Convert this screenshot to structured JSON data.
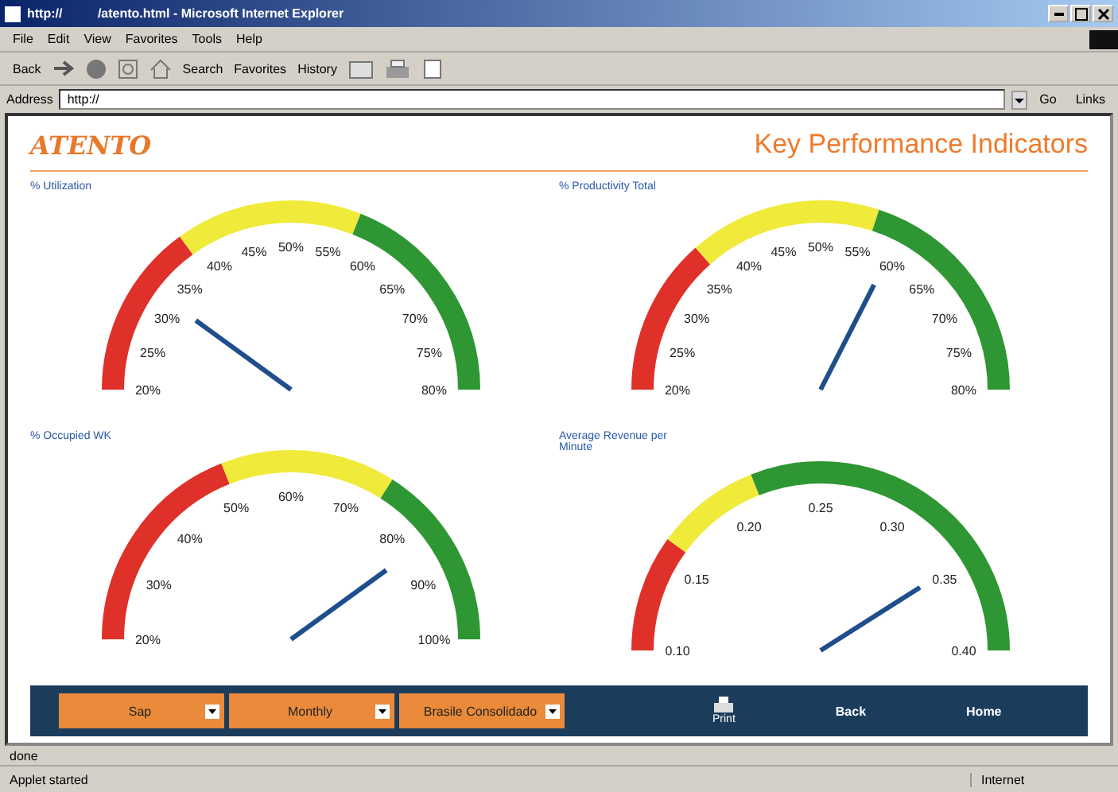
{
  "window": {
    "title": "http://          /atento.html - Microsoft Internet Explorer"
  },
  "menu": [
    "File",
    "Edit",
    "View",
    "Favorites",
    "Tools",
    "Help"
  ],
  "toolbar": [
    "Back",
    "Search",
    "Favorites",
    "History"
  ],
  "address": {
    "label": "Address",
    "value": "http://",
    "go": "Go",
    "links": "Links"
  },
  "page": {
    "logo": "ATENTO",
    "title": "Key Performance Indicators"
  },
  "gauges": [
    {
      "title": "% Utilization",
      "ticks": [
        "20%",
        "25%",
        "30%",
        "35%",
        "40%",
        "45%",
        "50%",
        "55%",
        "60%",
        "65%",
        "70%",
        "75%",
        "80%"
      ],
      "bands": [
        {
          "color": "#e0302a"
        },
        {
          "color": "#f0ea3a"
        },
        {
          "color": "#2e9632"
        }
      ]
    },
    {
      "title": "% Productivity Total",
      "ticks": [
        "20%",
        "25%",
        "30%",
        "35%",
        "40%",
        "45%",
        "50%",
        "55%",
        "60%",
        "65%",
        "70%",
        "75%",
        "80%"
      ],
      "bands": [
        {
          "color": "#e0302a"
        },
        {
          "color": "#f0ea3a"
        },
        {
          "color": "#2e9632"
        }
      ]
    },
    {
      "title": "% Occupied WK",
      "ticks": [
        "20%",
        "30%",
        "40%",
        "50%",
        "60%",
        "70%",
        "80%",
        "90%",
        "100%"
      ],
      "bands": [
        {
          "color": "#e0302a"
        },
        {
          "color": "#f0ea3a"
        },
        {
          "color": "#2e9632"
        }
      ]
    },
    {
      "title": "Average Revenue per Minute",
      "ticks": [
        "0.10",
        "0.15",
        "0.20",
        "0.25",
        "0.30",
        "0.35",
        "0.40"
      ],
      "bands": [
        {
          "color": "#e0302a"
        },
        {
          "color": "#f0ea3a"
        },
        {
          "color": "#2e9632"
        }
      ]
    }
  ],
  "controls": {
    "selects": [
      "Sap",
      "Monthly",
      "Brasile Consolidado"
    ],
    "print": "Print",
    "back": "Back",
    "home": "Home"
  },
  "status": {
    "page": "done",
    "applet": "Applet started",
    "zone": "Internet"
  }
}
